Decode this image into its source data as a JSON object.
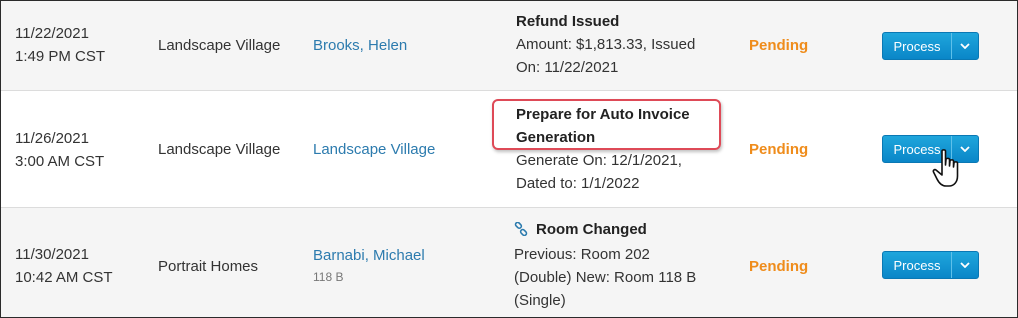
{
  "rows": [
    {
      "date": "11/22/2021",
      "time": "1:49 PM CST",
      "community": "Landscape Village",
      "resident": "Brooks, Helen",
      "event_title": "Refund Issued",
      "event_lines": [
        "Amount: $1,813.33, Issued",
        "On: 11/22/2021"
      ],
      "status": "Pending",
      "button": "Process"
    },
    {
      "date": "11/26/2021",
      "time": "3:00 AM CST",
      "community": "Landscape Village",
      "resident": "Landscape Village",
      "event_title_lines": [
        "Prepare for Auto Invoice",
        "Generation"
      ],
      "event_lines": [
        "Generate On: 12/1/2021,",
        "Dated to: 1/1/2022"
      ],
      "status": "Pending",
      "button": "Process"
    },
    {
      "date": "11/30/2021",
      "time": "10:42 AM CST",
      "community": "Portrait Homes",
      "resident": "Barnabi, Michael",
      "resident_sub": "118 B",
      "event_icon": "link-icon",
      "event_title": "Room Changed",
      "event_lines": [
        "Previous: Room 202",
        "(Double) New: Room 118 B",
        "(Single)"
      ],
      "status": "Pending",
      "button": "Process"
    }
  ],
  "colors": {
    "status_pending": "#ef8c1b",
    "link": "#2c7bae",
    "button": "#0a86c8",
    "highlight": "#de4a57"
  }
}
